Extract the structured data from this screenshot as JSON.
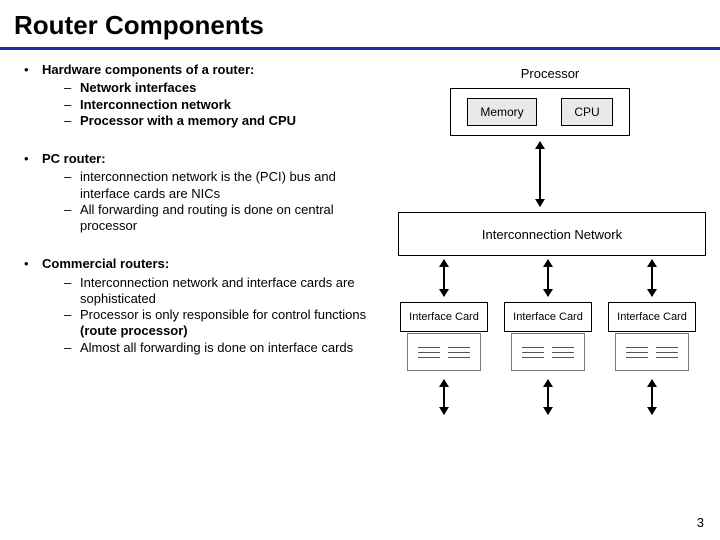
{
  "title": "Router Components",
  "page_number": "3",
  "sections": [
    {
      "lead": "Hardware components of a router:",
      "lead_bold": true,
      "subs": [
        {
          "text": "Network interfaces",
          "bold": true
        },
        {
          "text": "Interconnection network",
          "bold": true
        },
        {
          "text": "Processor with a memory and CPU",
          "bold": true
        }
      ]
    },
    {
      "lead": "PC router:",
      "lead_bold": true,
      "subs": [
        {
          "text": "interconnection network is the (PCI) bus  and interface cards are NICs",
          "bold": false
        },
        {
          "text": "All forwarding and routing is done on central processor",
          "bold": false
        }
      ]
    },
    {
      "lead": "Commercial routers:",
      "lead_bold": true,
      "subs": [
        {
          "text": "Interconnection network and interface cards are sophisticated",
          "bold": false
        },
        {
          "html": "Processor is only responsible for control functions <b>(route processor)</b>"
        },
        {
          "text": "Almost all forwarding is done on interface cards",
          "bold": false
        }
      ]
    }
  ],
  "diagram": {
    "processor_label": "Processor",
    "memory": "Memory",
    "cpu": "CPU",
    "interconnect": "Interconnection Network",
    "card": "Interface Card"
  }
}
